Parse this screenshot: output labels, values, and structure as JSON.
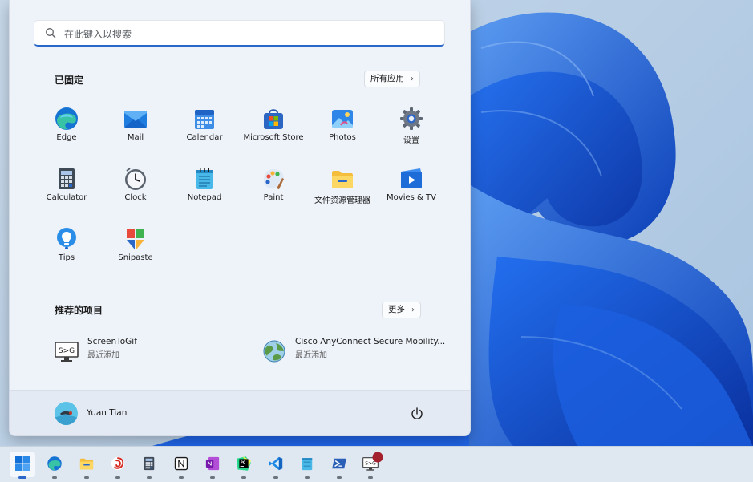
{
  "search": {
    "placeholder": "在此键入以搜索"
  },
  "pinned": {
    "title": "已固定",
    "all_apps_label": "所有应用",
    "apps": [
      {
        "label": "Edge",
        "icon": "edge-icon"
      },
      {
        "label": "Mail",
        "icon": "mail-icon"
      },
      {
        "label": "Calendar",
        "icon": "calendar-icon"
      },
      {
        "label": "Microsoft Store",
        "icon": "store-icon"
      },
      {
        "label": "Photos",
        "icon": "photos-icon"
      },
      {
        "label": "设置",
        "icon": "gear-icon"
      },
      {
        "label": "Calculator",
        "icon": "calculator-icon"
      },
      {
        "label": "Clock",
        "icon": "clock-icon"
      },
      {
        "label": "Notepad",
        "icon": "notepad-icon"
      },
      {
        "label": "Paint",
        "icon": "paint-icon"
      },
      {
        "label": "文件资源管理器",
        "icon": "folder-icon"
      },
      {
        "label": "Movies & TV",
        "icon": "movies-icon"
      },
      {
        "label": "Tips",
        "icon": "tips-icon"
      },
      {
        "label": "Snipaste",
        "icon": "snipaste-icon"
      }
    ]
  },
  "recommended": {
    "title": "推荐的项目",
    "more_label": "更多",
    "items": [
      {
        "title": "ScreenToGif",
        "subtitle": "最近添加",
        "icon": "screentogif-icon"
      },
      {
        "title": "Cisco AnyConnect Secure Mobility...",
        "subtitle": "最近添加",
        "icon": "cisco-globe-icon"
      }
    ]
  },
  "user": {
    "name": "Yuan Tian"
  },
  "taskbar": {
    "items": [
      {
        "name": "start",
        "icon": "windows-logo-icon",
        "active": true
      },
      {
        "name": "edge",
        "icon": "edge-icon"
      },
      {
        "name": "file-explorer",
        "icon": "folder-icon"
      },
      {
        "name": "app-red-swirl",
        "icon": "red-swirl-icon"
      },
      {
        "name": "calculator",
        "icon": "calculator-icon"
      },
      {
        "name": "notion",
        "icon": "notion-icon"
      },
      {
        "name": "onenote",
        "icon": "onenote-icon"
      },
      {
        "name": "pycharm",
        "icon": "pycharm-icon"
      },
      {
        "name": "vscode",
        "icon": "vscode-icon"
      },
      {
        "name": "notepad",
        "icon": "notepad-icon"
      },
      {
        "name": "powershell",
        "icon": "powershell-icon"
      },
      {
        "name": "screentogif",
        "icon": "screentogif-icon",
        "badge": "recording"
      }
    ]
  },
  "colors": {
    "accent": "#2a67c9",
    "wallpaper_blue": "#1459d9"
  }
}
